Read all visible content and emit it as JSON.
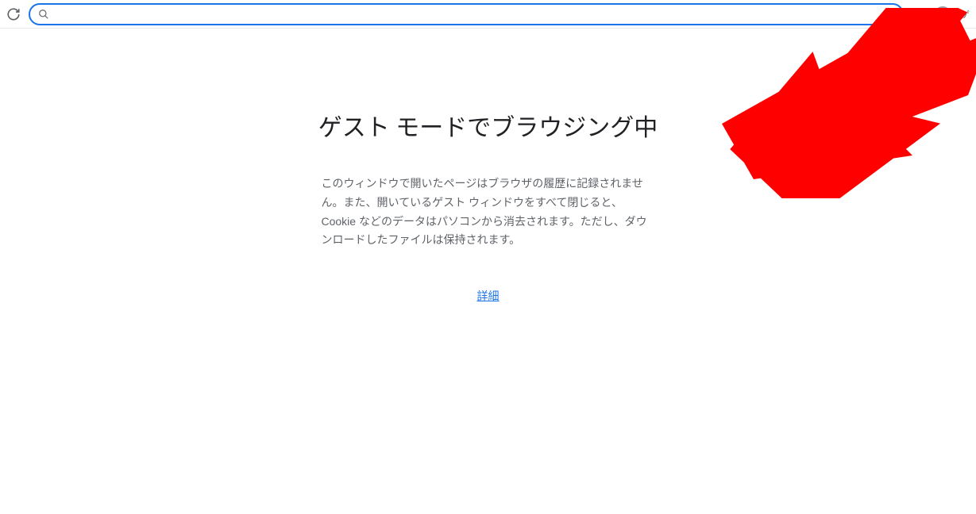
{
  "toolbar": {
    "address_value": "",
    "profile_label": "ゲ"
  },
  "page": {
    "title": "ゲスト モードでブラウジング中",
    "description": "このウィンドウで開いたページはブラウザの履歴に記録されません。また、開いているゲスト ウィンドウをすべて閉じると、Cookie などのデータはパソコンから消去されます。ただし、ダウンロードしたファイルは保持されます。",
    "details_link": "詳細"
  }
}
